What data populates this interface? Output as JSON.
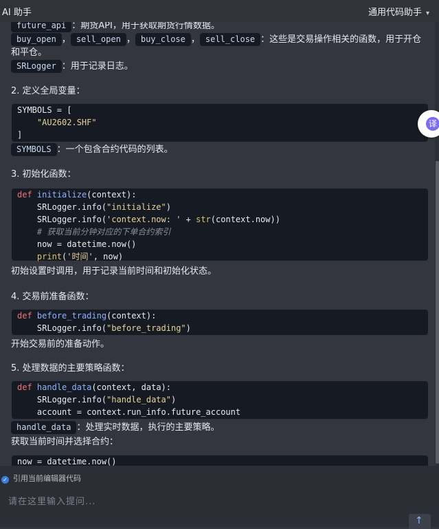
{
  "header": {
    "title": "AI 助手",
    "mode": "通用代码助手"
  },
  "content": {
    "intro_future_api_chip": "future_api",
    "intro_future_api_desc": "：期货API，用于获取期货行情数据。",
    "trade_chips": [
      "buy_open",
      "sell_open",
      "buy_close",
      "sell_close"
    ],
    "trade_sep": "，",
    "trade_desc_1": "：这些是交易操作相关的函数，用于开仓",
    "trade_desc_2": "和平仓。",
    "srlogger_chip": "SRLogger",
    "srlogger_desc": "：用于记录日志。",
    "h2": "2. 定义全局变量：",
    "code2": [
      "SYMBOLS = [",
      "    \"AU2602.SHF\"",
      "]"
    ],
    "symbols_chip": "SYMBOLS",
    "symbols_desc": "：一个包含合约代码的列表。",
    "h3": "3. 初始化函数：",
    "code3": {
      "l1_kw": "def",
      "l1_fn": "initialize",
      "l1_rest": "(context):",
      "l2_pre": "    SRLogger.info(",
      "l2_str": "\"initialize\"",
      "l2_post": ")",
      "l3_pre": "    SRLogger.info(",
      "l3_str": "'context.now: '",
      "l3_mid": " + ",
      "l3_bi": "str",
      "l3_post": "(context.now))",
      "l4_cm": "    # 获取当前分钟对应的下单合约索引",
      "l5": "    now = datetime.now()",
      "l6_pre": "    ",
      "l6_bi": "print",
      "l6_open": "(",
      "l6_str": "'时间'",
      "l6_post": ", now)"
    },
    "p3": "初始设置时调用，用于记录当前时间和初始化状态。",
    "h4": "4. 交易前准备函数：",
    "code4": {
      "l1_kw": "def",
      "l1_fn": "before_trading",
      "l1_rest": "(context):",
      "l2_pre": "    SRLogger.info(",
      "l2_str": "\"before_trading\"",
      "l2_post": ")"
    },
    "p4": "开始交易前的准备动作。",
    "h5": "5. 处理数据的主要策略函数：",
    "code5": {
      "l1_kw": "def",
      "l1_fn": "handle_data",
      "l1_rest": "(context, data):",
      "l2_pre": "    SRLogger.info(",
      "l2_str": "\"handle_data\"",
      "l2_post": ")",
      "l3": "    account = context.run_info.future_account"
    },
    "handle_data_chip": "handle_data",
    "handle_data_desc": "：处理实时数据，执行的主要策略。",
    "p5": "获取当前时间并选择合约：",
    "code6": "now = datetime.now()"
  },
  "translate_badge": "译",
  "footer": {
    "quote_label": "引用当前编辑器代码",
    "input_placeholder": "请在这里输入提问...",
    "send_icon": "arrow-up-icon",
    "check_icon": "check-icon"
  }
}
